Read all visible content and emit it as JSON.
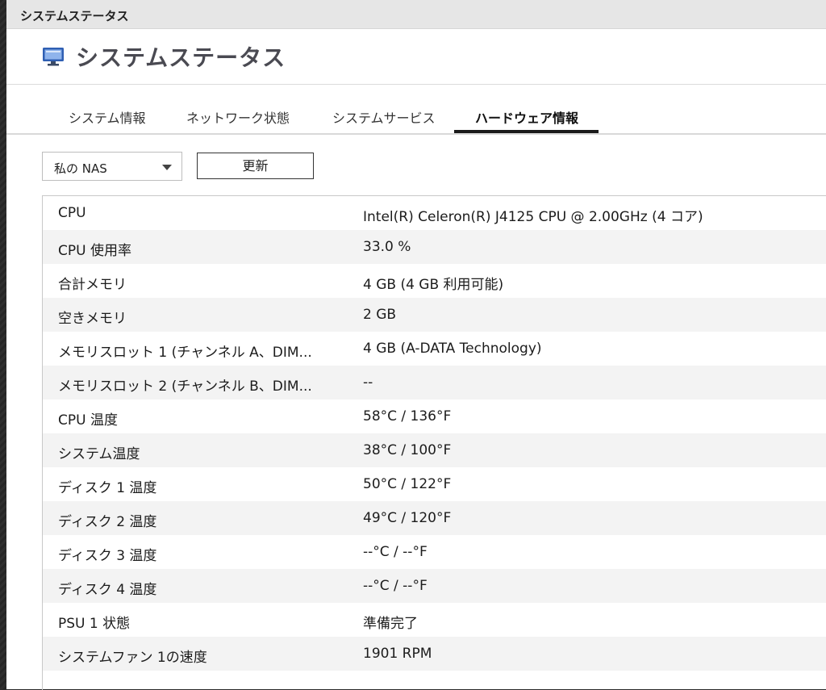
{
  "window": {
    "title": "システムステータス"
  },
  "header": {
    "title": "システムステータス",
    "icon": "monitor-icon"
  },
  "tabs": [
    {
      "label": "システム情報",
      "active": false
    },
    {
      "label": "ネットワーク状態",
      "active": false
    },
    {
      "label": "システムサービス",
      "active": false
    },
    {
      "label": "ハードウェア情報",
      "active": true
    }
  ],
  "controls": {
    "device_select": "私の NAS",
    "refresh_label": "更新"
  },
  "hardware": {
    "rows": [
      {
        "label": "CPU",
        "value": "Intel(R) Celeron(R) J4125 CPU @ 2.00GHz (4 コア)"
      },
      {
        "label": "CPU 使用率",
        "value": "33.0 %"
      },
      {
        "label": "合計メモリ",
        "value": "4 GB (4 GB 利用可能)"
      },
      {
        "label": "空きメモリ",
        "value": "2 GB"
      },
      {
        "label": "メモリスロット 1 (チャンネル A、DIM...",
        "value": "4 GB (A-DATA Technology)"
      },
      {
        "label": "メモリスロット 2 (チャンネル B、DIM...",
        "value": "--"
      },
      {
        "label": "CPU 温度",
        "value": "58°C / 136°F"
      },
      {
        "label": "システム温度",
        "value": "38°C / 100°F"
      },
      {
        "label": "ディスク 1 温度",
        "value": "50°C / 122°F"
      },
      {
        "label": "ディスク 2 温度",
        "value": "49°C / 120°F"
      },
      {
        "label": "ディスク 3 温度",
        "value": "--°C / --°F"
      },
      {
        "label": "ディスク 4 温度",
        "value": "--°C / --°F"
      },
      {
        "label": "PSU 1 状態",
        "value": "準備完了"
      },
      {
        "label": "システムファン 1の速度",
        "value": "1901 RPM"
      }
    ]
  },
  "colors": {
    "title": "#4a4a52",
    "active_tab_underline": "#1a1a1a",
    "row_alt": "#f3f3f3"
  }
}
